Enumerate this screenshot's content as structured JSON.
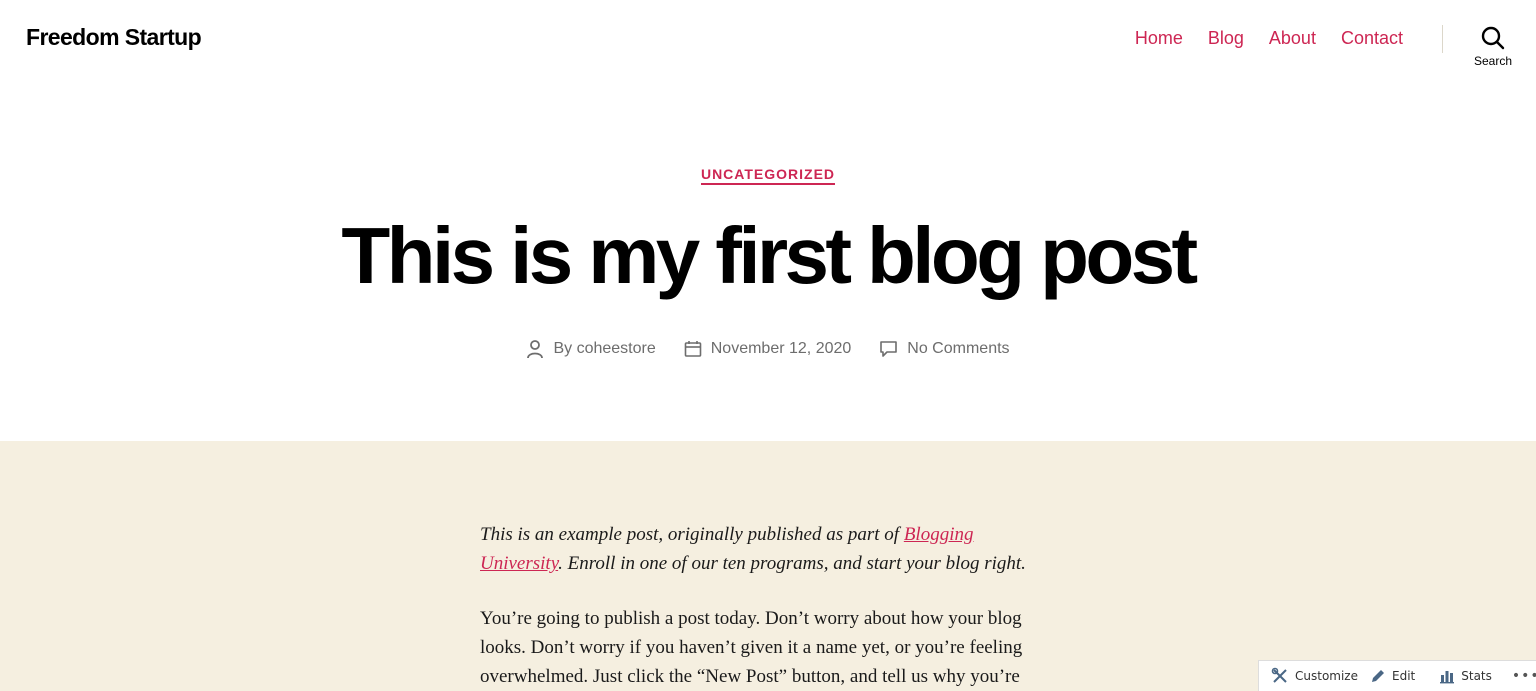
{
  "site": {
    "title": "Freedom Startup"
  },
  "nav": {
    "items": [
      "Home",
      "Blog",
      "About",
      "Contact"
    ]
  },
  "search": {
    "label": "Search"
  },
  "post": {
    "category": "UNCATEGORIZED",
    "title": "This is my first blog post",
    "author": "By coheestore",
    "date": "November 12, 2020",
    "comments": "No Comments"
  },
  "content": {
    "intro_before": "This is an example post, originally published as part of ",
    "intro_link": "Blogging University",
    "intro_after": ". Enroll in one of our ten programs, and start your blog right.",
    "paragraph": "You’re going to publish a post today. Don’t worry about how your blog looks. Don’t worry if you haven’t given it a name yet, or you’re feeling overwhelmed. Just click the “New Post” button, and tell us why you’re"
  },
  "actionbar": {
    "customize": "Customize",
    "edit": "Edit",
    "stats": "Stats",
    "more": "•••"
  },
  "colors": {
    "accent": "#cd2653",
    "content_bg": "#f5efe0"
  }
}
